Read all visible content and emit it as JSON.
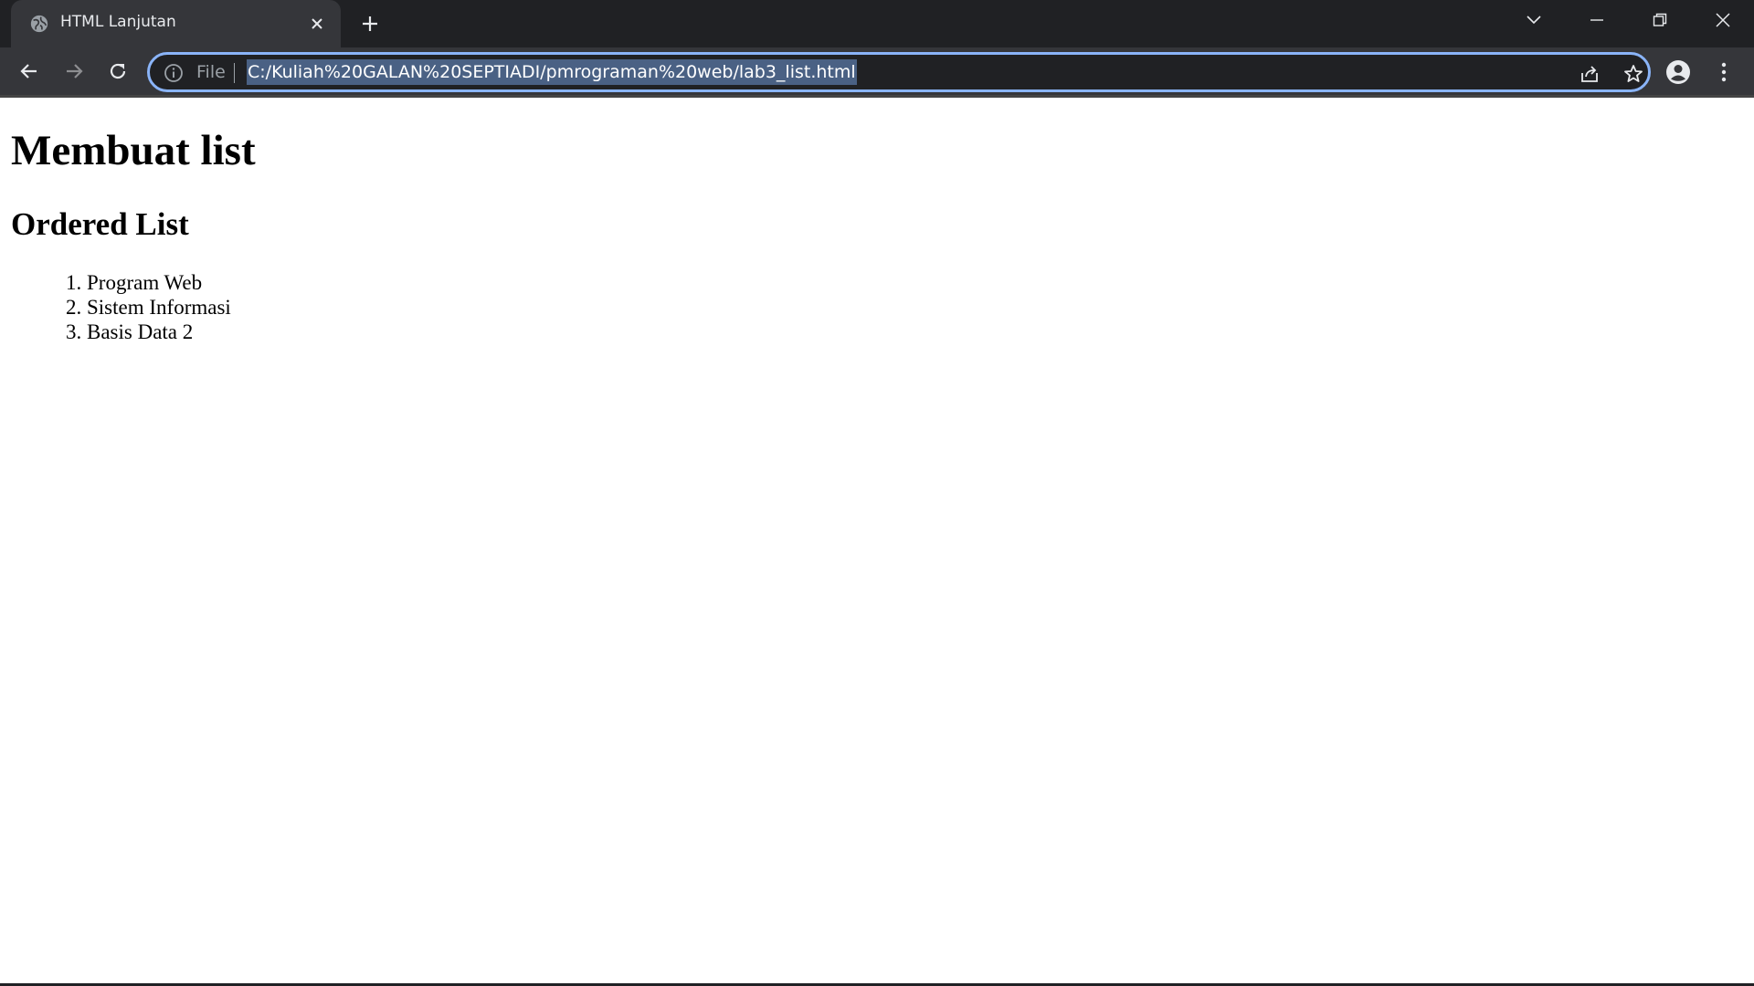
{
  "browser": {
    "tab": {
      "title": "HTML Lanjutan",
      "favicon": "globe-icon"
    },
    "address_bar": {
      "scheme_label": "File",
      "url": "C:/Kuliah%20GALAN%20SEPTIADI/pmrograman%20web/lab3_list.html"
    },
    "colors": {
      "tabstrip_bg": "#202124",
      "toolbar_bg": "#35363a",
      "omnibox_focus": "#8ab4f8",
      "url_selection": "#4a6184"
    }
  },
  "page": {
    "heading": "Membuat list",
    "subheading": "Ordered List",
    "list_items": [
      {
        "number": "1.",
        "text": "Program Web"
      },
      {
        "number": "2.",
        "text": "Sistem Informasi"
      },
      {
        "number": "3.",
        "text": "Basis Data 2"
      }
    ]
  }
}
